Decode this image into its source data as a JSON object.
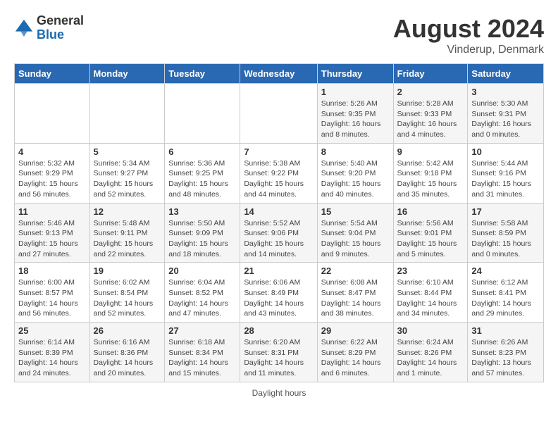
{
  "logo": {
    "general": "General",
    "blue": "Blue"
  },
  "title": "August 2024",
  "subtitle": "Vinderup, Denmark",
  "footer": "Daylight hours",
  "days_of_week": [
    "Sunday",
    "Monday",
    "Tuesday",
    "Wednesday",
    "Thursday",
    "Friday",
    "Saturday"
  ],
  "weeks": [
    [
      {
        "num": "",
        "sunrise": "",
        "sunset": "",
        "daylight": "",
        "empty": true
      },
      {
        "num": "",
        "sunrise": "",
        "sunset": "",
        "daylight": "",
        "empty": true
      },
      {
        "num": "",
        "sunrise": "",
        "sunset": "",
        "daylight": "",
        "empty": true
      },
      {
        "num": "",
        "sunrise": "",
        "sunset": "",
        "daylight": "",
        "empty": true
      },
      {
        "num": "1",
        "sunrise": "Sunrise: 5:26 AM",
        "sunset": "Sunset: 9:35 PM",
        "daylight": "Daylight: 16 hours and 8 minutes."
      },
      {
        "num": "2",
        "sunrise": "Sunrise: 5:28 AM",
        "sunset": "Sunset: 9:33 PM",
        "daylight": "Daylight: 16 hours and 4 minutes."
      },
      {
        "num": "3",
        "sunrise": "Sunrise: 5:30 AM",
        "sunset": "Sunset: 9:31 PM",
        "daylight": "Daylight: 16 hours and 0 minutes."
      }
    ],
    [
      {
        "num": "4",
        "sunrise": "Sunrise: 5:32 AM",
        "sunset": "Sunset: 9:29 PM",
        "daylight": "Daylight: 15 hours and 56 minutes."
      },
      {
        "num": "5",
        "sunrise": "Sunrise: 5:34 AM",
        "sunset": "Sunset: 9:27 PM",
        "daylight": "Daylight: 15 hours and 52 minutes."
      },
      {
        "num": "6",
        "sunrise": "Sunrise: 5:36 AM",
        "sunset": "Sunset: 9:25 PM",
        "daylight": "Daylight: 15 hours and 48 minutes."
      },
      {
        "num": "7",
        "sunrise": "Sunrise: 5:38 AM",
        "sunset": "Sunset: 9:22 PM",
        "daylight": "Daylight: 15 hours and 44 minutes."
      },
      {
        "num": "8",
        "sunrise": "Sunrise: 5:40 AM",
        "sunset": "Sunset: 9:20 PM",
        "daylight": "Daylight: 15 hours and 40 minutes."
      },
      {
        "num": "9",
        "sunrise": "Sunrise: 5:42 AM",
        "sunset": "Sunset: 9:18 PM",
        "daylight": "Daylight: 15 hours and 35 minutes."
      },
      {
        "num": "10",
        "sunrise": "Sunrise: 5:44 AM",
        "sunset": "Sunset: 9:16 PM",
        "daylight": "Daylight: 15 hours and 31 minutes."
      }
    ],
    [
      {
        "num": "11",
        "sunrise": "Sunrise: 5:46 AM",
        "sunset": "Sunset: 9:13 PM",
        "daylight": "Daylight: 15 hours and 27 minutes."
      },
      {
        "num": "12",
        "sunrise": "Sunrise: 5:48 AM",
        "sunset": "Sunset: 9:11 PM",
        "daylight": "Daylight: 15 hours and 22 minutes."
      },
      {
        "num": "13",
        "sunrise": "Sunrise: 5:50 AM",
        "sunset": "Sunset: 9:09 PM",
        "daylight": "Daylight: 15 hours and 18 minutes."
      },
      {
        "num": "14",
        "sunrise": "Sunrise: 5:52 AM",
        "sunset": "Sunset: 9:06 PM",
        "daylight": "Daylight: 15 hours and 14 minutes."
      },
      {
        "num": "15",
        "sunrise": "Sunrise: 5:54 AM",
        "sunset": "Sunset: 9:04 PM",
        "daylight": "Daylight: 15 hours and 9 minutes."
      },
      {
        "num": "16",
        "sunrise": "Sunrise: 5:56 AM",
        "sunset": "Sunset: 9:01 PM",
        "daylight": "Daylight: 15 hours and 5 minutes."
      },
      {
        "num": "17",
        "sunrise": "Sunrise: 5:58 AM",
        "sunset": "Sunset: 8:59 PM",
        "daylight": "Daylight: 15 hours and 0 minutes."
      }
    ],
    [
      {
        "num": "18",
        "sunrise": "Sunrise: 6:00 AM",
        "sunset": "Sunset: 8:57 PM",
        "daylight": "Daylight: 14 hours and 56 minutes."
      },
      {
        "num": "19",
        "sunrise": "Sunrise: 6:02 AM",
        "sunset": "Sunset: 8:54 PM",
        "daylight": "Daylight: 14 hours and 52 minutes."
      },
      {
        "num": "20",
        "sunrise": "Sunrise: 6:04 AM",
        "sunset": "Sunset: 8:52 PM",
        "daylight": "Daylight: 14 hours and 47 minutes."
      },
      {
        "num": "21",
        "sunrise": "Sunrise: 6:06 AM",
        "sunset": "Sunset: 8:49 PM",
        "daylight": "Daylight: 14 hours and 43 minutes."
      },
      {
        "num": "22",
        "sunrise": "Sunrise: 6:08 AM",
        "sunset": "Sunset: 8:47 PM",
        "daylight": "Daylight: 14 hours and 38 minutes."
      },
      {
        "num": "23",
        "sunrise": "Sunrise: 6:10 AM",
        "sunset": "Sunset: 8:44 PM",
        "daylight": "Daylight: 14 hours and 34 minutes."
      },
      {
        "num": "24",
        "sunrise": "Sunrise: 6:12 AM",
        "sunset": "Sunset: 8:41 PM",
        "daylight": "Daylight: 14 hours and 29 minutes."
      }
    ],
    [
      {
        "num": "25",
        "sunrise": "Sunrise: 6:14 AM",
        "sunset": "Sunset: 8:39 PM",
        "daylight": "Daylight: 14 hours and 24 minutes."
      },
      {
        "num": "26",
        "sunrise": "Sunrise: 6:16 AM",
        "sunset": "Sunset: 8:36 PM",
        "daylight": "Daylight: 14 hours and 20 minutes."
      },
      {
        "num": "27",
        "sunrise": "Sunrise: 6:18 AM",
        "sunset": "Sunset: 8:34 PM",
        "daylight": "Daylight: 14 hours and 15 minutes."
      },
      {
        "num": "28",
        "sunrise": "Sunrise: 6:20 AM",
        "sunset": "Sunset: 8:31 PM",
        "daylight": "Daylight: 14 hours and 11 minutes."
      },
      {
        "num": "29",
        "sunrise": "Sunrise: 6:22 AM",
        "sunset": "Sunset: 8:29 PM",
        "daylight": "Daylight: 14 hours and 6 minutes."
      },
      {
        "num": "30",
        "sunrise": "Sunrise: 6:24 AM",
        "sunset": "Sunset: 8:26 PM",
        "daylight": "Daylight: 14 hours and 1 minute."
      },
      {
        "num": "31",
        "sunrise": "Sunrise: 6:26 AM",
        "sunset": "Sunset: 8:23 PM",
        "daylight": "Daylight: 13 hours and 57 minutes."
      }
    ]
  ]
}
